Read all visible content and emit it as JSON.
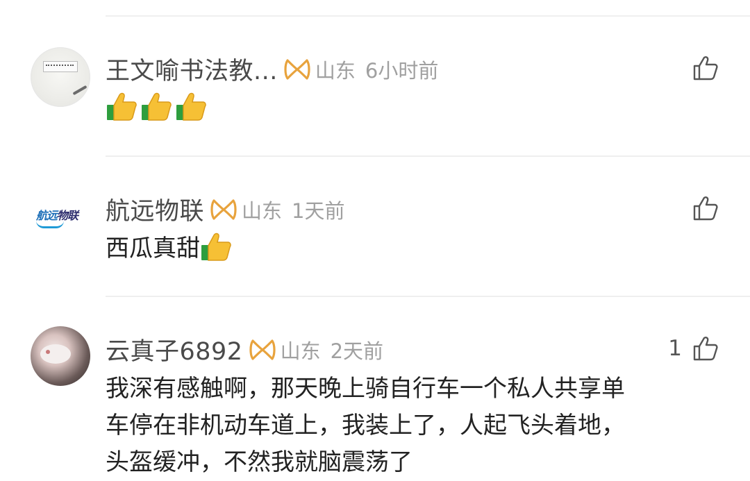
{
  "comments": [
    {
      "username": "王文喻书法教...",
      "location": "山东",
      "time": "6小时前",
      "like_count": "",
      "content_text": "",
      "content_emojis": [
        "thumbs-up",
        "thumbs-up",
        "thumbs-up"
      ]
    },
    {
      "username": "航远物联",
      "avatar_logo_text_a": "航远",
      "avatar_logo_text_b": "物联",
      "location": "山东",
      "time": "1天前",
      "like_count": "",
      "content_text": "西瓜真甜",
      "content_emojis": [
        "thumbs-up"
      ]
    },
    {
      "username": "云真子6892",
      "location": "山东",
      "time": "2天前",
      "like_count": "1",
      "content_lines": [
        "我深有感触啊，那天晚上骑自行车一个私人共享单",
        "车停在非机动车道上，我装上了，人起飞头着地，",
        "头盔缓冲，不然我就脑震荡了"
      ]
    }
  ],
  "colors": {
    "vip_badge": "#e8a33d",
    "meta_gray": "#a0a0a0",
    "divider": "#efefef"
  }
}
